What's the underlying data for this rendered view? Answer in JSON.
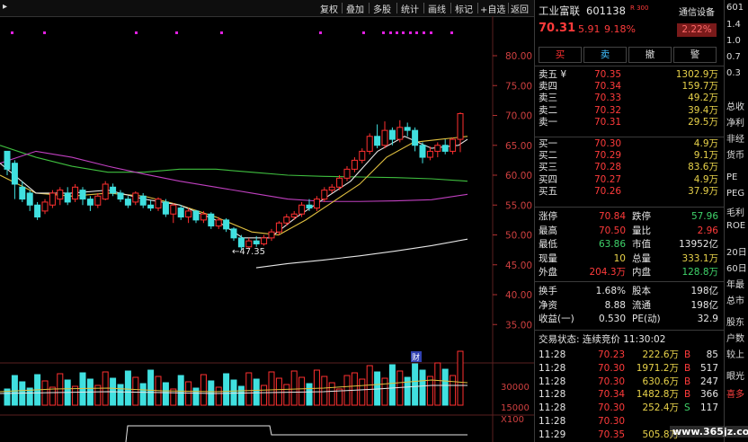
{
  "toolbar": {
    "items": [
      "复权",
      "叠加",
      "多股",
      "统计",
      "画线",
      "标记",
      "+自选",
      "返回"
    ]
  },
  "chart": {
    "price_axis": [
      "80.00",
      "75.00",
      "70.00",
      "65.00",
      "60.00",
      "55.00",
      "50.00",
      "45.00",
      "40.00",
      "35.00"
    ],
    "low_marker": "47.35",
    "fin_marker": "财",
    "vol_axis": [
      "30000",
      "15000",
      "X100"
    ]
  },
  "quote": {
    "name": "工业富联",
    "code": "601138",
    "tag": "R 300",
    "price": "70.31",
    "change": "5.91",
    "change_pct": "9.18%",
    "sector": "通信设备",
    "sector_pct": "2.22%",
    "buttons": [
      "买",
      "卖",
      "撤",
      "警"
    ],
    "asks": [
      {
        "label": "卖五 ¥",
        "price": "70.35",
        "vol": "1302.9万"
      },
      {
        "label": "卖四",
        "price": "70.34",
        "vol": "159.7万"
      },
      {
        "label": "卖三",
        "price": "70.33",
        "vol": "49.2万"
      },
      {
        "label": "卖二",
        "price": "70.32",
        "vol": "39.4万"
      },
      {
        "label": "卖一",
        "price": "70.31",
        "vol": "29.5万"
      }
    ],
    "bids": [
      {
        "label": "买一",
        "price": "70.30",
        "vol": "4.9万"
      },
      {
        "label": "买二",
        "price": "70.29",
        "vol": "9.1万"
      },
      {
        "label": "买三",
        "price": "70.28",
        "vol": "83.6万"
      },
      {
        "label": "买四",
        "price": "70.27",
        "vol": "4.9万"
      },
      {
        "label": "买五",
        "price": "70.26",
        "vol": "37.9万"
      }
    ],
    "stats": [
      {
        "l1": "涨停",
        "v1": "70.84",
        "l2": "跌停",
        "v2": "57.96"
      },
      {
        "l1": "最高",
        "v1": "70.50",
        "l2": "量比",
        "v2": "2.96"
      },
      {
        "l1": "最低",
        "v1": "63.86",
        "l2": "市值",
        "v2": "13952亿"
      },
      {
        "l1": "现量",
        "v1": "10",
        "l2": "总量",
        "v2": "333.1万"
      },
      {
        "l1": "外盘",
        "v1": "204.3万",
        "l2": "内盘",
        "v2": "128.8万"
      }
    ],
    "stats2": [
      {
        "l1": "换手",
        "v1": "1.68%",
        "l2": "股本",
        "v2": "198亿"
      },
      {
        "l1": "净资",
        "v1": "8.88",
        "l2": "流通",
        "v2": "198亿"
      },
      {
        "l1": "收益(一)",
        "v1": "0.530",
        "l2": "PE(动)",
        "v2": "32.9"
      }
    ],
    "trade_status": "交易状态: 连续竞价 11:30:02",
    "ticks": [
      {
        "time": "11:28",
        "price": "70.23",
        "vol": "222.6万",
        "bs": "B",
        "n": "85"
      },
      {
        "time": "11:28",
        "price": "70.30",
        "vol": "1971.2万",
        "bs": "B",
        "n": "517"
      },
      {
        "time": "11:28",
        "price": "70.30",
        "vol": "630.6万",
        "bs": "B",
        "n": "247"
      },
      {
        "time": "11:28",
        "price": "70.34",
        "vol": "1482.8万",
        "bs": "B",
        "n": "366"
      },
      {
        "time": "11:28",
        "price": "70.30",
        "vol": "252.4万",
        "bs": "S",
        "n": "117"
      },
      {
        "time": "11:28",
        "price": "70.30",
        "vol": "",
        "bs": "",
        "n": ""
      },
      {
        "time": "11:29",
        "price": "70.35",
        "vol": "505.8万",
        "bs": "",
        "n": ""
      }
    ]
  },
  "side": {
    "items": [
      "601",
      "1.4",
      "1.0",
      "0.7",
      "0.3",
      "总收",
      "净利",
      "非经",
      "货币",
      "PE",
      "PEG",
      "毛利",
      "ROE",
      "20日",
      "60日",
      "年最",
      "总市",
      "股东",
      "户数",
      "较上",
      "眼光",
      "喜多"
    ]
  },
  "watermark": "www.365jz.com"
}
